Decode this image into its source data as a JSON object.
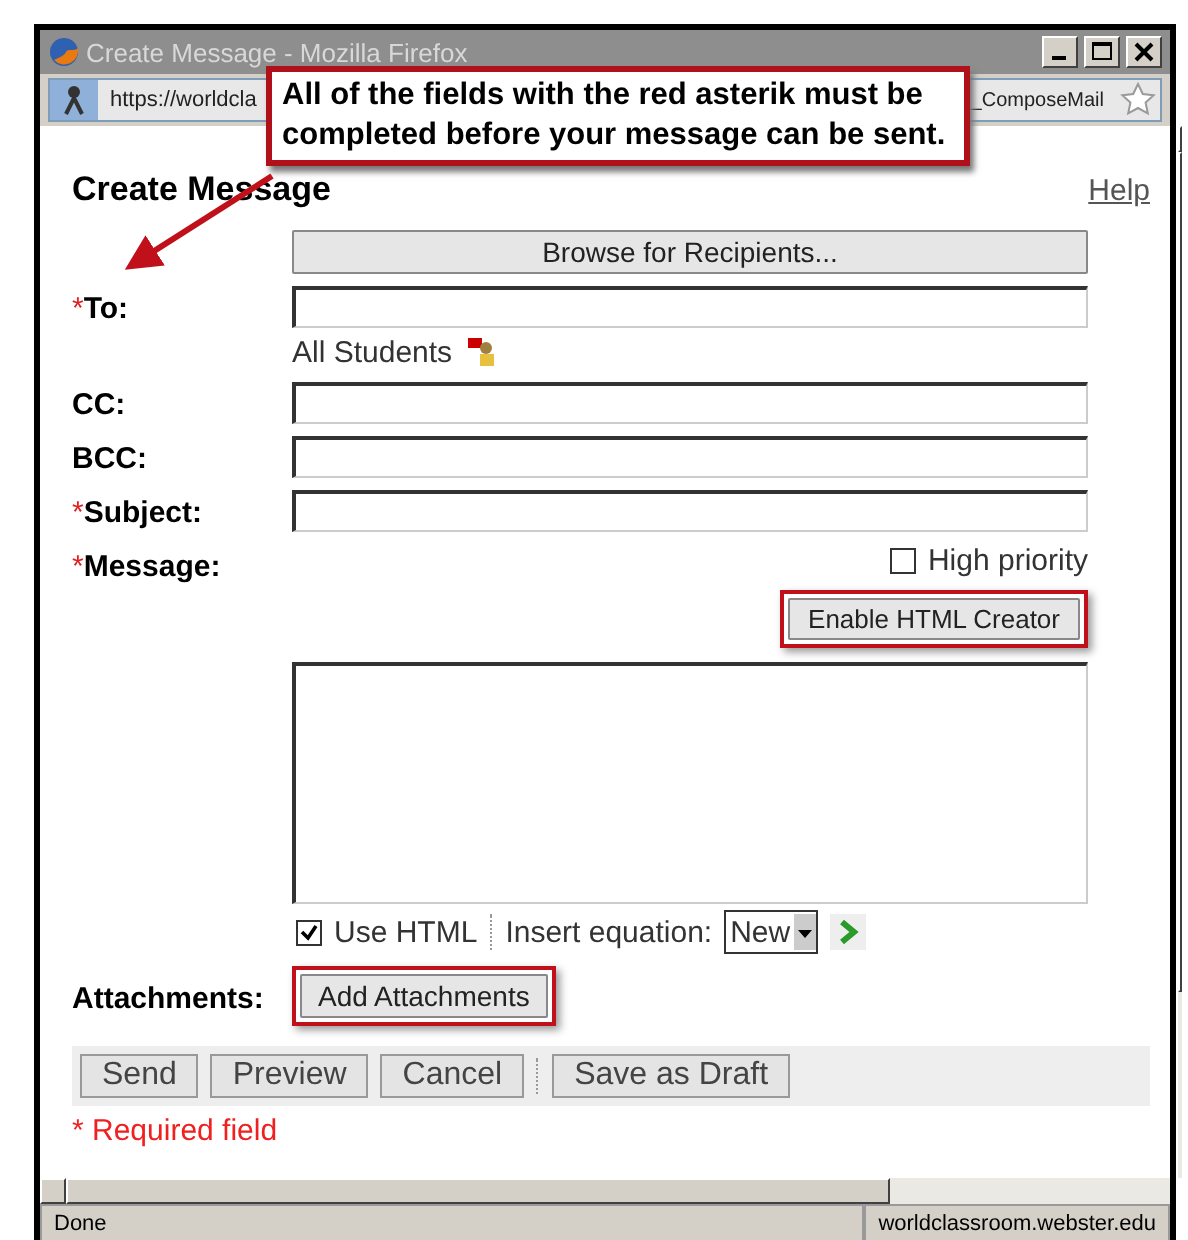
{
  "window": {
    "title": "Create Message - Mozilla Firefox"
  },
  "address_bar": {
    "url_start": "https://worldcla",
    "url_end": "_ComposeMail"
  },
  "callout": {
    "text": "All of the fields with the red asterik must be completed before your message can be sent."
  },
  "page": {
    "heading": "Create Message",
    "help": "Help",
    "required_mark": "*",
    "browse_button": "Browse for Recipients...",
    "fields": [
      {
        "kind": "to",
        "label": "To:",
        "required": true,
        "note": "All Students"
      },
      {
        "kind": "input",
        "label": "CC:",
        "required": false
      },
      {
        "kind": "input",
        "label": "BCC:",
        "required": false
      },
      {
        "kind": "input",
        "label": "Subject:",
        "required": true
      },
      {
        "kind": "message",
        "label": "Message:",
        "required": true
      }
    ],
    "high_priority": {
      "label": "High priority",
      "checked": false
    },
    "html_button": "Enable HTML Creator",
    "use_html": {
      "label": "Use HTML",
      "checked": true
    },
    "equation": {
      "label": "Insert equation:",
      "value": "New"
    },
    "attachments": {
      "label": "Attachments:",
      "button": "Add Attachments"
    },
    "actions": [
      "Send",
      "Preview",
      "Cancel",
      "Save as Draft"
    ],
    "required_note": "* Required field"
  },
  "status_bar": {
    "text": "Done",
    "domain": "worldclassroom.webster.edu"
  }
}
